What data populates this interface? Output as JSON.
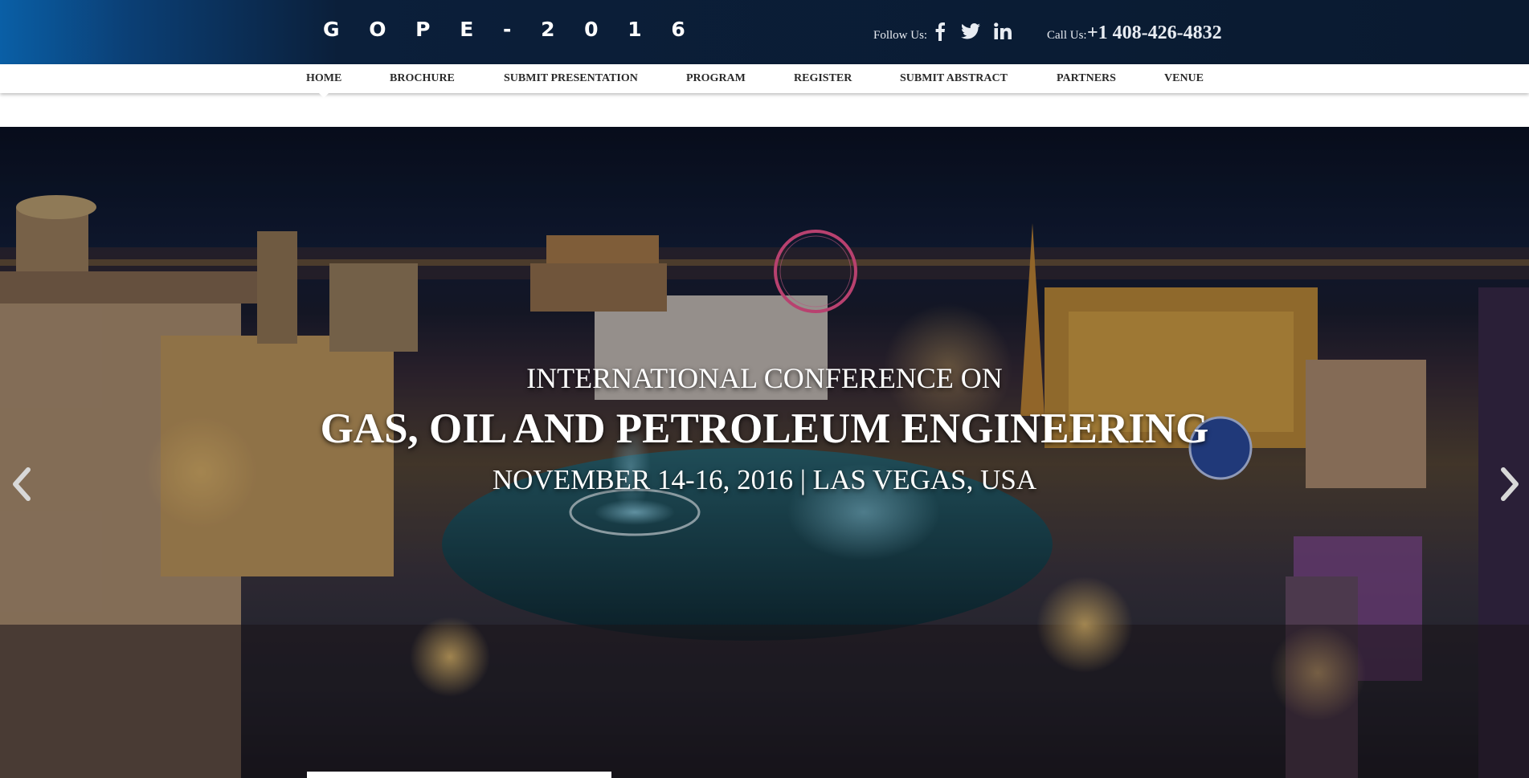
{
  "header": {
    "logo": "G O P E - 2 0 1 6",
    "follow_label": "Follow Us:",
    "social": [
      "facebook-icon",
      "twitter-icon",
      "linkedin-icon"
    ],
    "call_label": "Call Us:",
    "phone": "+1 408-426-4832"
  },
  "nav": {
    "items": [
      "HOME",
      "BROCHURE",
      "SUBMIT PRESENTATION",
      "PROGRAM",
      "REGISTER",
      "SUBMIT ABSTRACT",
      "PARTNERS",
      "VENUE"
    ],
    "active": "HOME"
  },
  "hero": {
    "line1": "INTERNATIONAL CONFERENCE ON",
    "line2": "GAS, OIL AND PETROLEUM ENGINEERING",
    "line3": "NOVEMBER 14-16, 2016 | LAS VEGAS, USA",
    "prev_icon": "chevron-left-icon",
    "next_icon": "chevron-right-icon"
  },
  "colors": {
    "header_bg": "#0a1a30",
    "header_accent": "#0a5fa6",
    "nav_text": "#2a2a2a",
    "hero_text": "#ffffff"
  }
}
